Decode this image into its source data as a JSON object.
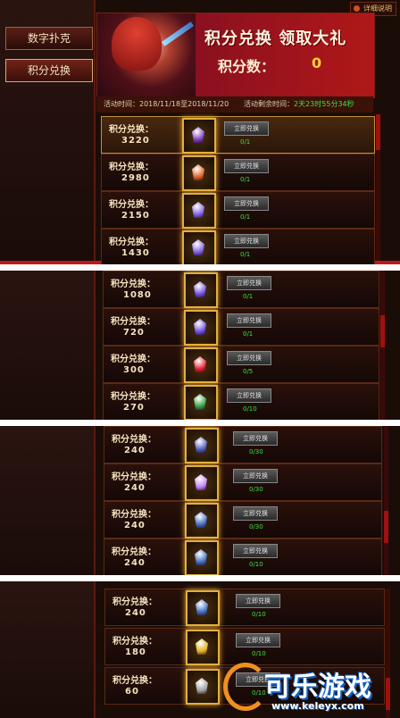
{
  "sidebar": {
    "items": [
      {
        "label": "数字扑克"
      },
      {
        "label": "积分兑换"
      }
    ]
  },
  "guide_label": "详细说明",
  "banner": {
    "title": "积分兑换 领取大礼",
    "points_label": "积分数：",
    "points_value": "0"
  },
  "activity": {
    "time": "活动时间：2018/11/18至2018/11/20",
    "remaining_label": "活动剩余时间：",
    "remaining_value": "2天23时55分34秒"
  },
  "row_label": "积分兑换：",
  "button_label": "立即兑换",
  "panels": [
    {
      "rows": [
        {
          "points": "3220",
          "count": "0/1",
          "item_icon": "purple-chest-icon",
          "color": "#8040c0",
          "highlight": true
        },
        {
          "points": "2980",
          "count": "0/1",
          "item_icon": "orange-pouch-icon",
          "color": "#e06020"
        },
        {
          "points": "2150",
          "count": "0/1",
          "item_icon": "purple-gem-icon",
          "color": "#8060e0"
        },
        {
          "points": "1430",
          "count": "0/1",
          "item_icon": "purple-gem-icon",
          "color": "#8060e0"
        }
      ]
    },
    {
      "rows": [
        {
          "points": "1080",
          "count": "0/1",
          "item_icon": "purple-gem-icon",
          "color": "#7050e0"
        },
        {
          "points": "720",
          "count": "0/1",
          "item_icon": "purple-gem-icon",
          "color": "#7050e0"
        },
        {
          "points": "300",
          "count": "0/5",
          "item_icon": "red-gem-icon",
          "color": "#e02030"
        },
        {
          "points": "270",
          "count": "0/10",
          "item_icon": "green-potion-icon",
          "color": "#30a040"
        }
      ]
    },
    {
      "rows": [
        {
          "points": "240",
          "count": "0/30",
          "item_icon": "scroll-box-icon",
          "color": "#5060c0"
        },
        {
          "points": "240",
          "count": "0/30",
          "item_icon": "glowing-orb-icon",
          "color": "#c080ff"
        },
        {
          "points": "240",
          "count": "0/30",
          "item_icon": "blue-chest-icon",
          "color": "#4070c0"
        },
        {
          "points": "240",
          "count": "0/10",
          "item_icon": "blue-chest-icon",
          "color": "#4070c0"
        }
      ]
    },
    {
      "rows": [
        {
          "points": "240",
          "count": "0/10",
          "item_icon": "blue-chest-icon",
          "color": "#4070c0"
        },
        {
          "points": "180",
          "count": "0/10",
          "item_icon": "gold-ingot-icon",
          "color": "#e0b020"
        },
        {
          "points": "60",
          "count": "0/10",
          "item_icon": "horse-statue-icon",
          "color": "#a0a0a0"
        }
      ]
    }
  ],
  "watermark": {
    "text": "可乐游戏",
    "url": "www.keleyx.com"
  }
}
